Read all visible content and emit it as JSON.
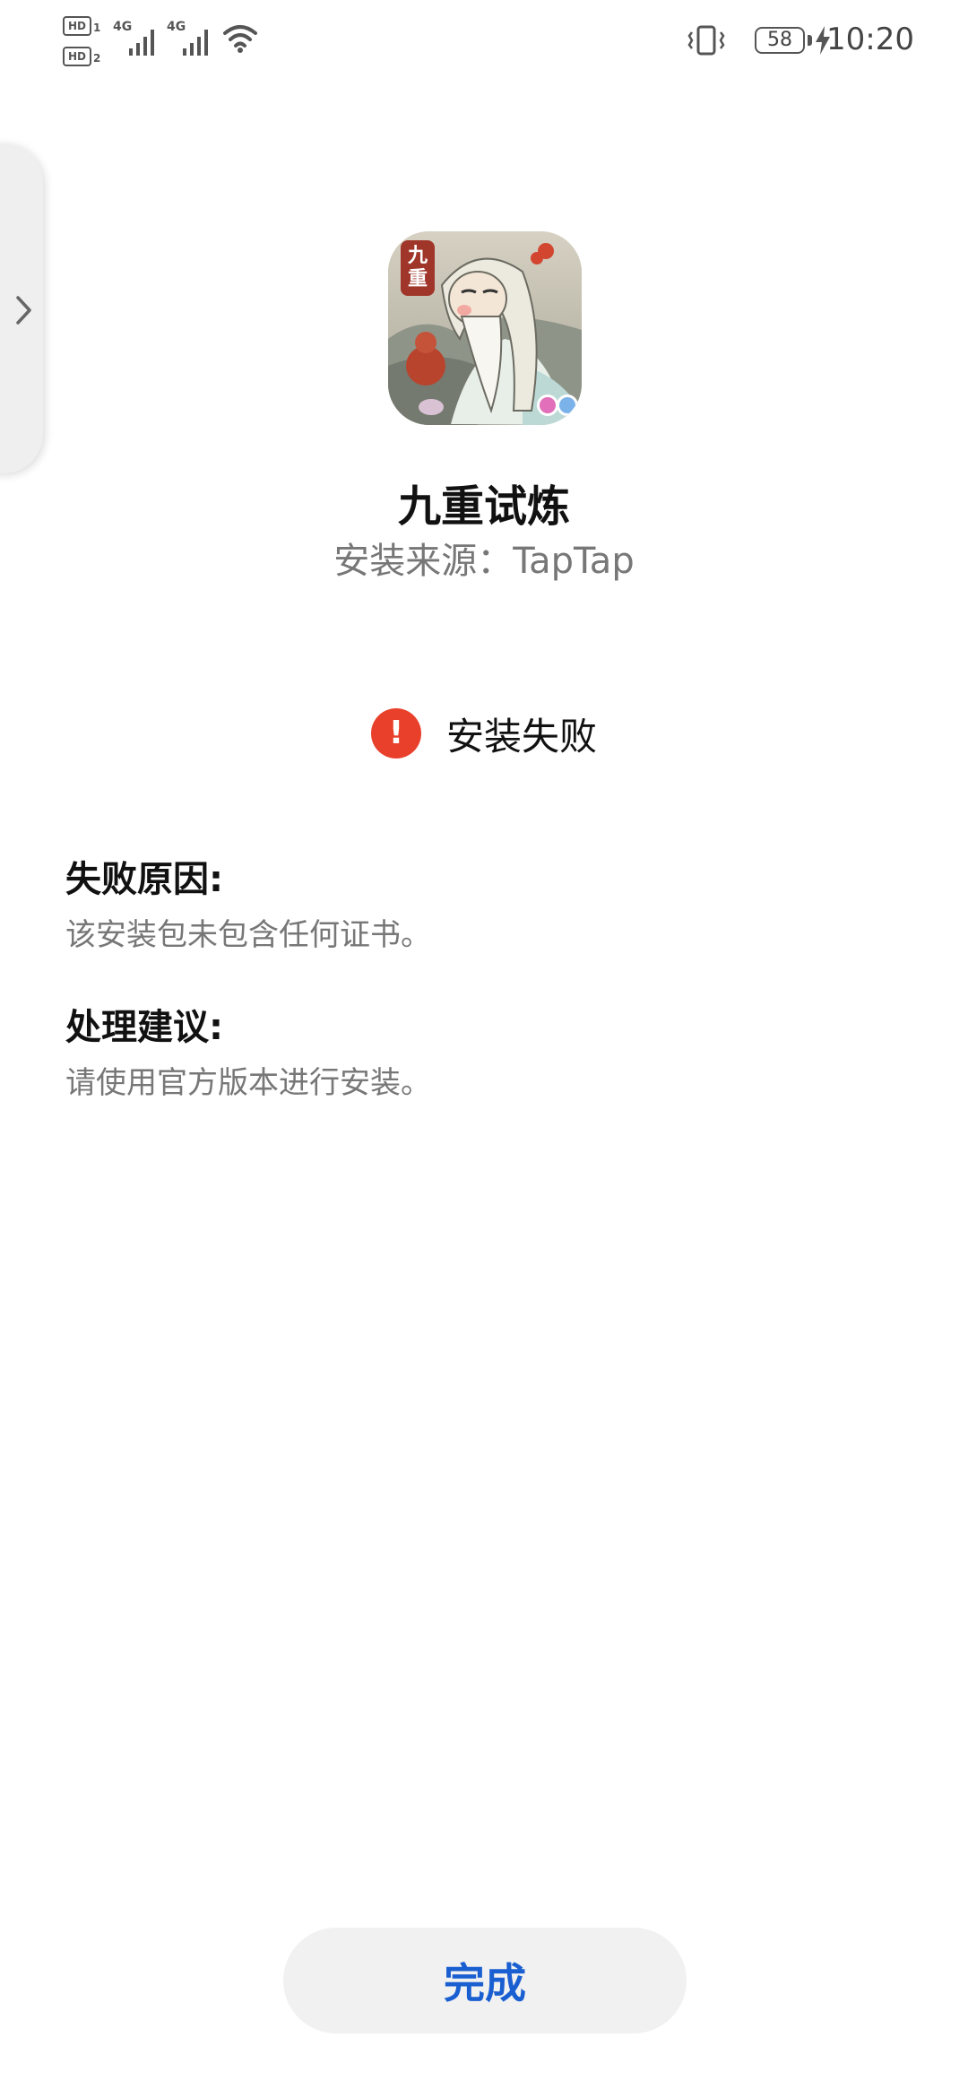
{
  "status_bar": {
    "hd1_label": "HD",
    "hd1_sub": "1",
    "hd2_label": "HD",
    "hd2_sub": "2",
    "sim1_network": "4G",
    "sim2_network": "4G",
    "battery_level": "58",
    "time": "10:20",
    "icons": [
      "signal-icon",
      "wifi-icon",
      "vibrate-icon",
      "charging-icon"
    ]
  },
  "side_handle": {
    "icon": "chevron-right-icon"
  },
  "app": {
    "icon_badge_text": "九重",
    "name": "九重试炼",
    "source": "安装来源：TapTap"
  },
  "result": {
    "status_icon": "error-icon",
    "status_icon_glyph": "!",
    "status_color": "#e8402a",
    "status_text": "安装失败"
  },
  "reason": {
    "title": "失败原因:",
    "body": "该安装包未包含任何证书。"
  },
  "suggestion": {
    "title": "处理建议:",
    "body": "请使用官方版本进行安装。"
  },
  "actions": {
    "done_label": "完成",
    "accent_color": "#1a5fd1"
  }
}
